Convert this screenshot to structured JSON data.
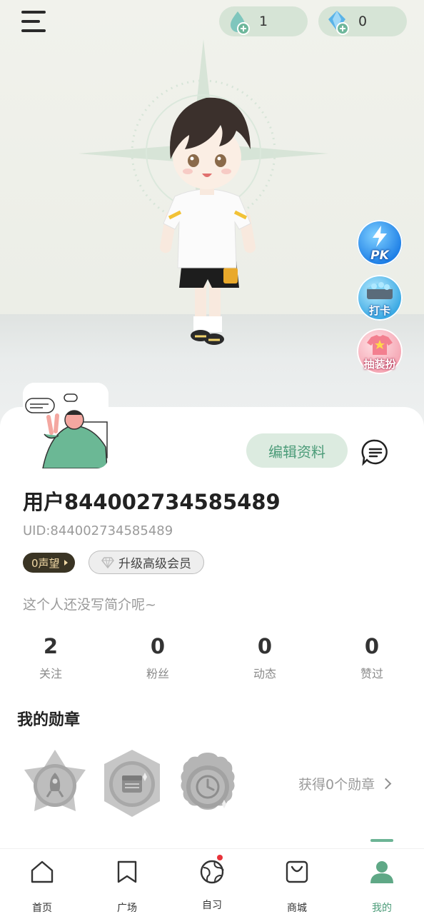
{
  "header": {
    "menu_icon": "menu-icon",
    "currency": [
      {
        "icon": "water-drop-icon",
        "value": "1"
      },
      {
        "icon": "diamond-icon",
        "value": "0"
      }
    ]
  },
  "side_actions": [
    {
      "label": "PK",
      "icon": "lightning-icon"
    },
    {
      "label": "打卡",
      "icon": "treasure-chest-icon"
    },
    {
      "label": "抽装扮",
      "icon": "shirt-icon"
    }
  ],
  "profile": {
    "edit_label": "编辑资料",
    "username": "用户844002734585489",
    "uid": "UID:844002734585489",
    "reputation": "0声望",
    "vip_label": "升级高级会员",
    "bio": "这个人还没写简介呢~"
  },
  "stats": [
    {
      "value": "2",
      "label": "关注"
    },
    {
      "value": "0",
      "label": "粉丝"
    },
    {
      "value": "0",
      "label": "动态"
    },
    {
      "value": "0",
      "label": "赞过"
    }
  ],
  "medals": {
    "title": "我的勋章",
    "link": "获得0个勋章",
    "items": [
      "rocket-medal-icon",
      "calendar-medal-icon",
      "clock-medal-icon"
    ]
  },
  "nav": [
    {
      "label": "首页",
      "icon": "home-icon"
    },
    {
      "label": "广场",
      "icon": "book-icon"
    },
    {
      "label": "自习",
      "icon": "globe-icon"
    },
    {
      "label": "商城",
      "icon": "shopping-bag-icon"
    },
    {
      "label": "我的",
      "icon": "person-icon"
    }
  ],
  "colors": {
    "accent": "#4c9c79",
    "card": "#ffffff",
    "edit_bg": "#dcebe0"
  }
}
